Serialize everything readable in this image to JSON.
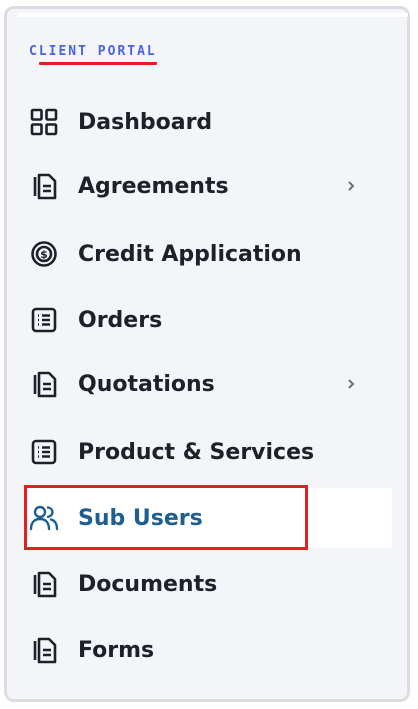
{
  "portal": {
    "section_title": "CLIENT PORTAL"
  },
  "nav": {
    "items": [
      {
        "id": "dashboard",
        "label": "Dashboard",
        "icon": "grid-icon",
        "has_submenu": false,
        "active": false
      },
      {
        "id": "agreements",
        "label": "Agreements",
        "icon": "document-icon",
        "has_submenu": true,
        "active": false
      },
      {
        "id": "credit-application",
        "label": "Credit Application",
        "icon": "dollar-coin-icon",
        "has_submenu": false,
        "active": false
      },
      {
        "id": "orders",
        "label": "Orders",
        "icon": "list-icon",
        "has_submenu": false,
        "active": false
      },
      {
        "id": "quotations",
        "label": "Quotations",
        "icon": "document-icon",
        "has_submenu": true,
        "active": false
      },
      {
        "id": "product-services",
        "label": "Product & Services",
        "icon": "list-icon",
        "has_submenu": false,
        "active": false
      },
      {
        "id": "sub-users",
        "label": "Sub Users",
        "icon": "users-icon",
        "has_submenu": false,
        "active": true
      },
      {
        "id": "documents",
        "label": "Documents",
        "icon": "document-icon",
        "has_submenu": false,
        "active": false
      },
      {
        "id": "forms",
        "label": "Forms",
        "icon": "document-icon",
        "has_submenu": false,
        "active": false
      }
    ]
  },
  "colors": {
    "accent": "#4a63e0",
    "active_text": "#1d5f93",
    "highlight_border": "#e41f1f",
    "sidebar_bg": "#f4f5f9"
  }
}
